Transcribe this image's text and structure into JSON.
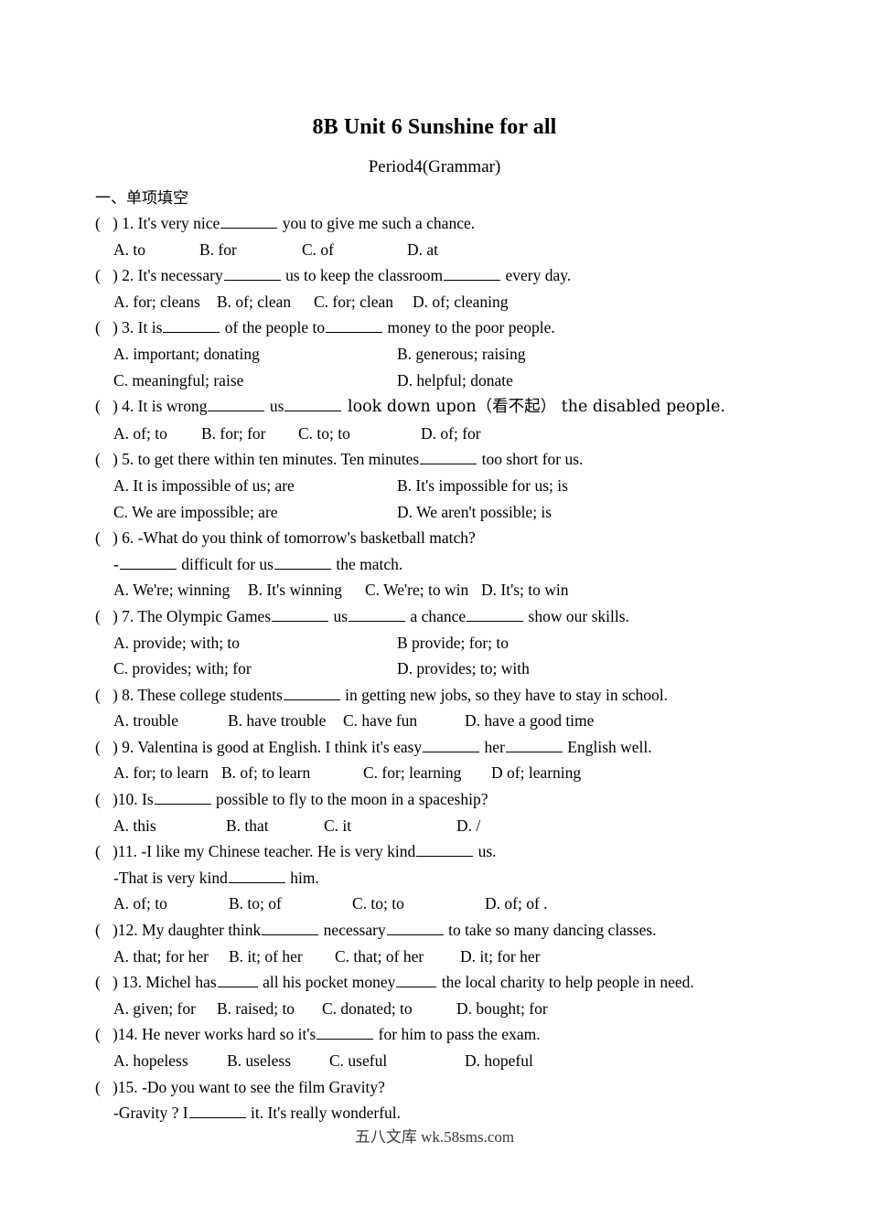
{
  "document": {
    "title": "8B Unit 6 Sunshine for all",
    "subtitle": "Period4(Grammar)",
    "section_heading": "一、单项填空"
  },
  "questions": [
    {
      "number": "1",
      "bracket": "(   ) 1. ",
      "stem_before": "It's very nice",
      "stem_after": " you to give me such a chance.",
      "layout": "inline4",
      "options": [
        "A. to",
        "B. for",
        "C. of",
        "D. at"
      ]
    },
    {
      "number": "2",
      "bracket": "(   ) 2. ",
      "stem_before": "It's necessary",
      "stem_mid": " us to keep the classroom",
      "stem_after": " every day.",
      "layout": "inline4",
      "options": [
        "A. for; cleans",
        "B. of; clean",
        "C. for; clean",
        "D. of; cleaning"
      ]
    },
    {
      "number": "3",
      "bracket": "(   ) 3. ",
      "stem_before": "It is",
      "stem_mid": " of the people to",
      "stem_after": " money to the poor people.",
      "layout": "twocol",
      "options": [
        "A. important; donating",
        "B. generous; raising",
        "C. meaningful; raise",
        "D. helpful; donate"
      ]
    },
    {
      "number": "4",
      "bracket": "(   ) 4. ",
      "stem_before": "It is wrong",
      "stem_mid": " us",
      "stem_after": " look down upon（看不起） the disabled people.",
      "layout": "inline4",
      "options": [
        "A. of; to",
        "B. for; for",
        "C. to; to",
        "D. of; for"
      ]
    },
    {
      "number": "5",
      "bracket": "(   ) 5. ",
      "stem_before": "to get there within ten minutes. Ten minutes",
      "stem_after": " too short for us.",
      "layout": "twocol",
      "options": [
        "A. It is impossible of us; are",
        "B. It's impossible for us; is",
        "C. We are impossible; are",
        "D. We aren't possible; is"
      ]
    },
    {
      "number": "6",
      "bracket": "(   ) 6. ",
      "stem_line1": "-What do you think of tomorrow's basketball match?",
      "stem_line2_before": "-",
      "stem_line2_mid": " difficult for us",
      "stem_line2_after": " the match.",
      "layout": "inline4",
      "options": [
        "A. We're; winning",
        "B. It's winning",
        "C. We're; to win",
        "D. It's; to win"
      ]
    },
    {
      "number": "7",
      "bracket": "(   ) 7. ",
      "stem_before": "The Olympic Games",
      "stem_mid": " us",
      "stem_mid2": " a chance",
      "stem_after": " show our skills.",
      "layout": "twocol",
      "options": [
        "A. provide; with; to",
        "B provide; for; to",
        "C. provides; with; for",
        "D. provides; to; with"
      ]
    },
    {
      "number": "8",
      "bracket": "(   ) 8. ",
      "stem_before": "These college students",
      "stem_after": " in getting new jobs, so they have to stay in school.",
      "layout": "inline4",
      "options": [
        "A. trouble",
        "B. have trouble",
        "C. have fun",
        "D. have a good time"
      ]
    },
    {
      "number": "9",
      "bracket": "(   ) 9. ",
      "stem_before": "Valentina is good at English. I think it's easy",
      "stem_mid": " her",
      "stem_after": " English well.",
      "layout": "inline4",
      "options": [
        "A. for; to learn",
        "B. of; to learn",
        "C. for; learning",
        "D of; learning"
      ]
    },
    {
      "number": "10",
      "bracket": "(   )10. ",
      "stem_before": "Is",
      "stem_after": " possible to fly to the moon in a spaceship?",
      "layout": "inline4",
      "options": [
        "A. this",
        "B. that",
        "C. it",
        "D. /"
      ]
    },
    {
      "number": "11",
      "bracket": "(   )11. ",
      "stem_line1_before": "-I like my Chinese teacher. He is very kind",
      "stem_line1_after": " us.",
      "stem_line2_before": "-That is very kind",
      "stem_line2_after": " him.",
      "layout": "inline4",
      "options": [
        "A. of; to",
        "B. to; of",
        "C. to; to",
        "D. of; of ."
      ]
    },
    {
      "number": "12",
      "bracket": "(   )12. ",
      "stem_before": "My daughter think",
      "stem_mid": " necessary",
      "stem_after": " to take so many dancing classes.",
      "layout": "inline4",
      "options": [
        "A. that; for her",
        "B. it; of her",
        "C. that; of her",
        "D. it; for her"
      ]
    },
    {
      "number": "13",
      "bracket": "(   ) 13. ",
      "stem_before": "Michel has",
      "stem_mid": " all his pocket money",
      "stem_after": " the local charity to help people in need.",
      "layout": "inline4",
      "options": [
        "A. given; for",
        "B. raised; to",
        "C. donated; to",
        "D. bought; for"
      ]
    },
    {
      "number": "14",
      "bracket": "(   )14. ",
      "stem_before": "He never works hard so it's",
      "stem_after": " for him to pass the exam.",
      "layout": "inline4",
      "options": [
        "A. hopeless",
        "B. useless",
        "C. useful",
        "D. hopeful"
      ]
    },
    {
      "number": "15",
      "bracket": "(   )15. ",
      "stem_line1": "-Do you want to see the film Gravity?",
      "stem_line2_before": "-Gravity ? I",
      "stem_line2_after": " it. It's really wonderful.",
      "layout": "none",
      "options": []
    }
  ],
  "footer": {
    "mark": "五八文库",
    "url": "wk.58sms.com"
  }
}
